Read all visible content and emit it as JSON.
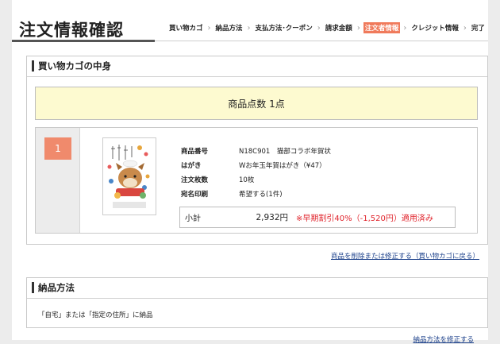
{
  "header": {
    "title": "注文情報確認",
    "steps": [
      {
        "label": "買い物カゴ",
        "active": false
      },
      {
        "label": "納品方法",
        "active": false
      },
      {
        "label": "支払方法･クーポン",
        "active": false
      },
      {
        "label": "請求金額",
        "active": false
      },
      {
        "label": "注文者情報",
        "active": true
      },
      {
        "label": "クレジット情報",
        "active": false
      },
      {
        "label": "完了",
        "active": false
      }
    ],
    "separator": "›"
  },
  "cart": {
    "section_title": "買い物カゴの中身",
    "count_banner": "商品点数 1点",
    "item": {
      "number": "1",
      "details": [
        {
          "label": "商品番号",
          "value": "N18C901　猫部コラボ年賀状"
        },
        {
          "label": "はがき",
          "value": "Wお年玉年賀はがき（¥47）"
        },
        {
          "label": "注文枚数",
          "value": "10枚"
        },
        {
          "label": "宛名印刷",
          "value": "希望する(1件)"
        }
      ],
      "subtotal_label": "小計",
      "subtotal_amount": "2,932円",
      "subtotal_discount": "※早期割引40%（-1,520円）適用済み"
    },
    "edit_link": "商品を削除または修正する（買い物カゴに戻る）"
  },
  "delivery": {
    "section_title": "納品方法",
    "text": "「自宅」または「指定の住所」に納品",
    "edit_link": "納品方法を修正する"
  },
  "colors": {
    "active_step": "#f07a5b",
    "banner_bg": "#fdfad0",
    "item_number_bg": "#f08a6c",
    "discount_text": "#e0242c",
    "link": "#1a3f8a"
  }
}
